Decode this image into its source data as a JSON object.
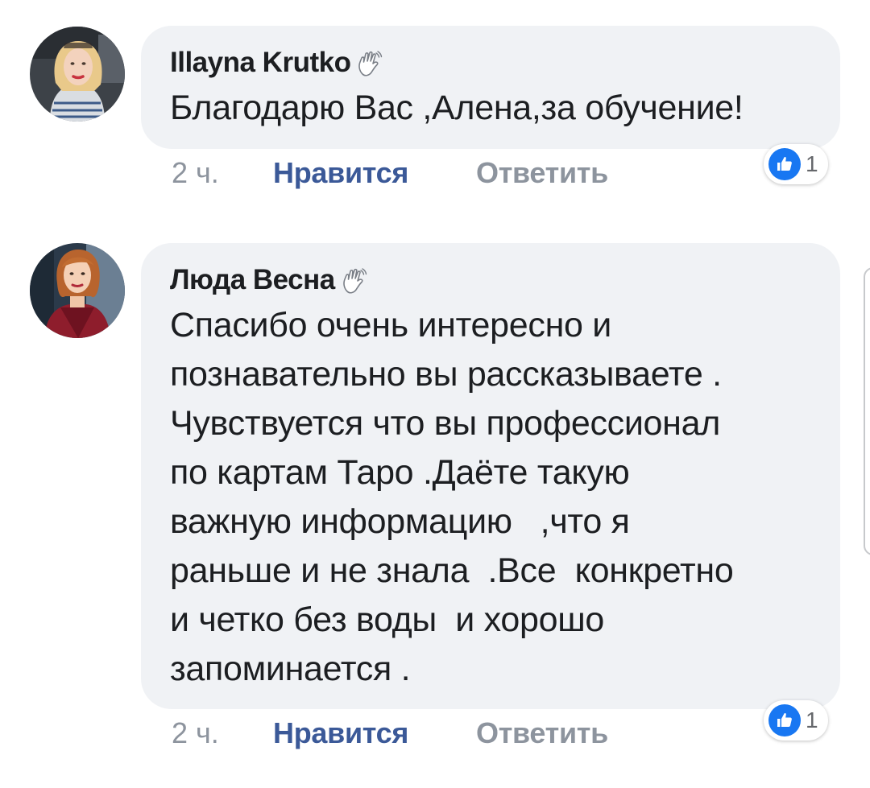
{
  "comments": [
    {
      "author": "Illayna Krutko",
      "author_icon": "waving-hand-icon",
      "text": "Благодарю Вас ,Алена,за обучение!",
      "time": "2 ч.",
      "like_label": "Нравится",
      "reply_label": "Ответить",
      "reaction_icon": "like-icon",
      "reaction_count": "1"
    },
    {
      "author": "Люда Весна",
      "author_icon": "waving-hand-icon",
      "text": "Спасибо очень интересно и\nпознавательно вы рассказываете .\nЧувствуется что вы профессионал\nпо картам Таро .Даёте такую\nважную информацию   ,что я\nраньше и не знала  .Все  конкретно\nи четко без воды  и хорошо\nзапоминается .",
      "time": "2 ч.",
      "like_label": "Нравится",
      "reply_label": "Ответить",
      "reaction_icon": "like-icon",
      "reaction_count": "1"
    }
  ],
  "colors": {
    "bubble_bg": "#f0f2f5",
    "link_blue": "#3b5998",
    "muted_gray": "#8d949e",
    "like_blue": "#1877f2"
  }
}
